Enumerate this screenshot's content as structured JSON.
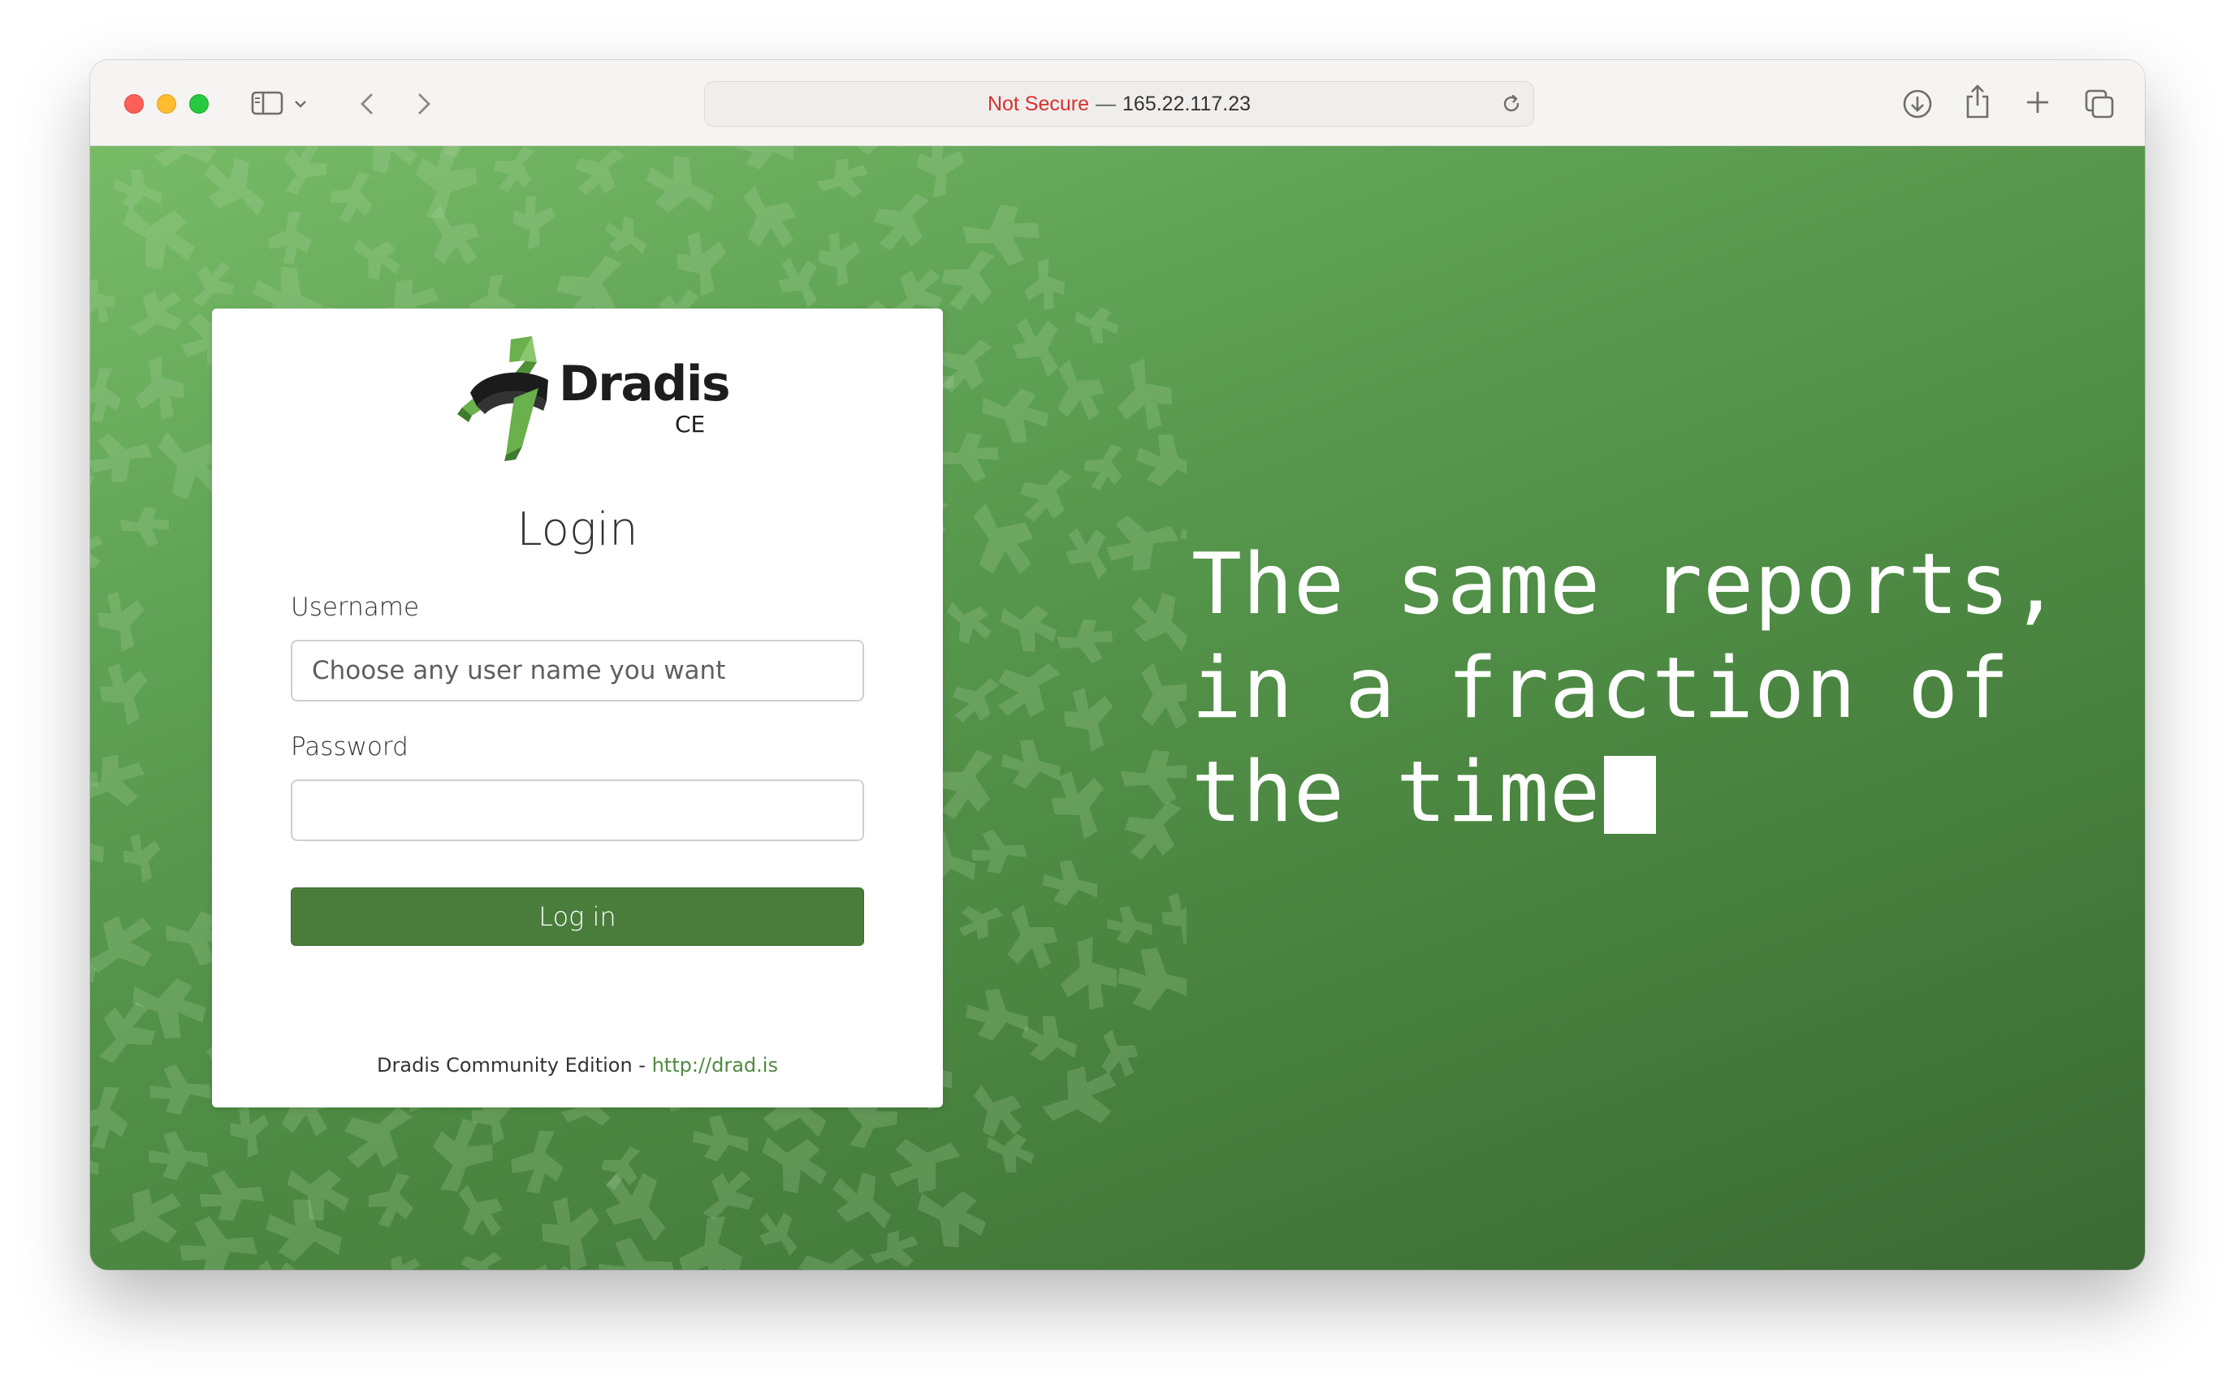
{
  "browser": {
    "address": {
      "security_label": "Not Secure",
      "separator": "—",
      "host": "165.22.117.23"
    },
    "icons": {
      "sidebar": "sidebar-icon",
      "back": "chevron-left-icon",
      "forward": "chevron-right-icon",
      "reload": "reload-icon",
      "downloads": "download-icon",
      "share": "share-icon",
      "new_tab": "plus-icon",
      "tabs": "tabs-overview-icon"
    }
  },
  "brand": {
    "name": "Dradis",
    "edition": "CE"
  },
  "login": {
    "title": "Login",
    "username_label": "Username",
    "username_placeholder": "Choose any user name you want",
    "username_value": "",
    "password_label": "Password",
    "password_value": "",
    "submit_label": "Log in"
  },
  "footer": {
    "text": "Dradis Community Edition - ",
    "link_text": "http://drad.is"
  },
  "tagline": {
    "lines": [
      "The same reports,",
      "in a fraction of",
      "the time"
    ]
  },
  "colors": {
    "primary_green": "#4a7d3c",
    "link_green": "#4f8a40",
    "insecure_red": "#d8302f"
  }
}
